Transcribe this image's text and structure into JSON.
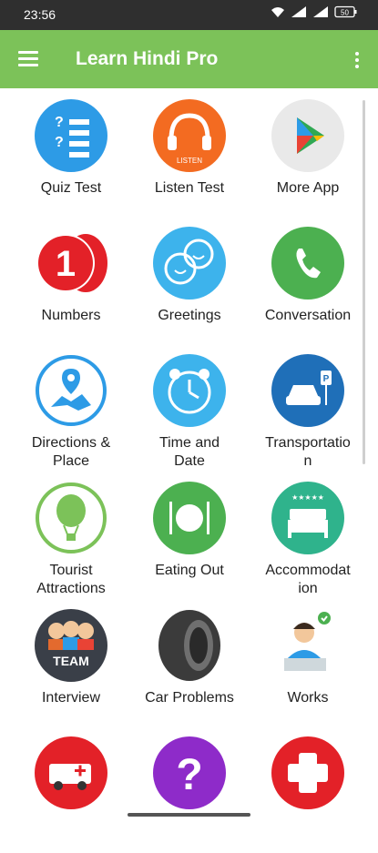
{
  "status": {
    "time": "23:56",
    "battery": "50"
  },
  "app_bar": {
    "title": "Learn Hindi Pro"
  },
  "tiles": [
    {
      "label": "Quiz Test"
    },
    {
      "label": "Listen Test",
      "badge": "LISTEN"
    },
    {
      "label": "More App"
    },
    {
      "label": "Numbers",
      "badge": "1"
    },
    {
      "label": "Greetings"
    },
    {
      "label": "Conversation"
    },
    {
      "label": "Directions &\nPlace"
    },
    {
      "label": "Time and\nDate"
    },
    {
      "label": "Transportatio\nn"
    },
    {
      "label": "Tourist\nAttractions"
    },
    {
      "label": "Eating Out"
    },
    {
      "label": "Accommodat\nion"
    },
    {
      "label": "Interview",
      "badge": "TEAM"
    },
    {
      "label": "Car Problems"
    },
    {
      "label": "Works"
    },
    {
      "label": ""
    },
    {
      "label": ""
    },
    {
      "label": ""
    }
  ],
  "colors": {
    "app_bar": "#7cc259",
    "status_bar": "#2f2f2f",
    "accent_blue": "#2d9be6",
    "accent_green": "#2fb36b",
    "accent_red": "#e32128"
  }
}
